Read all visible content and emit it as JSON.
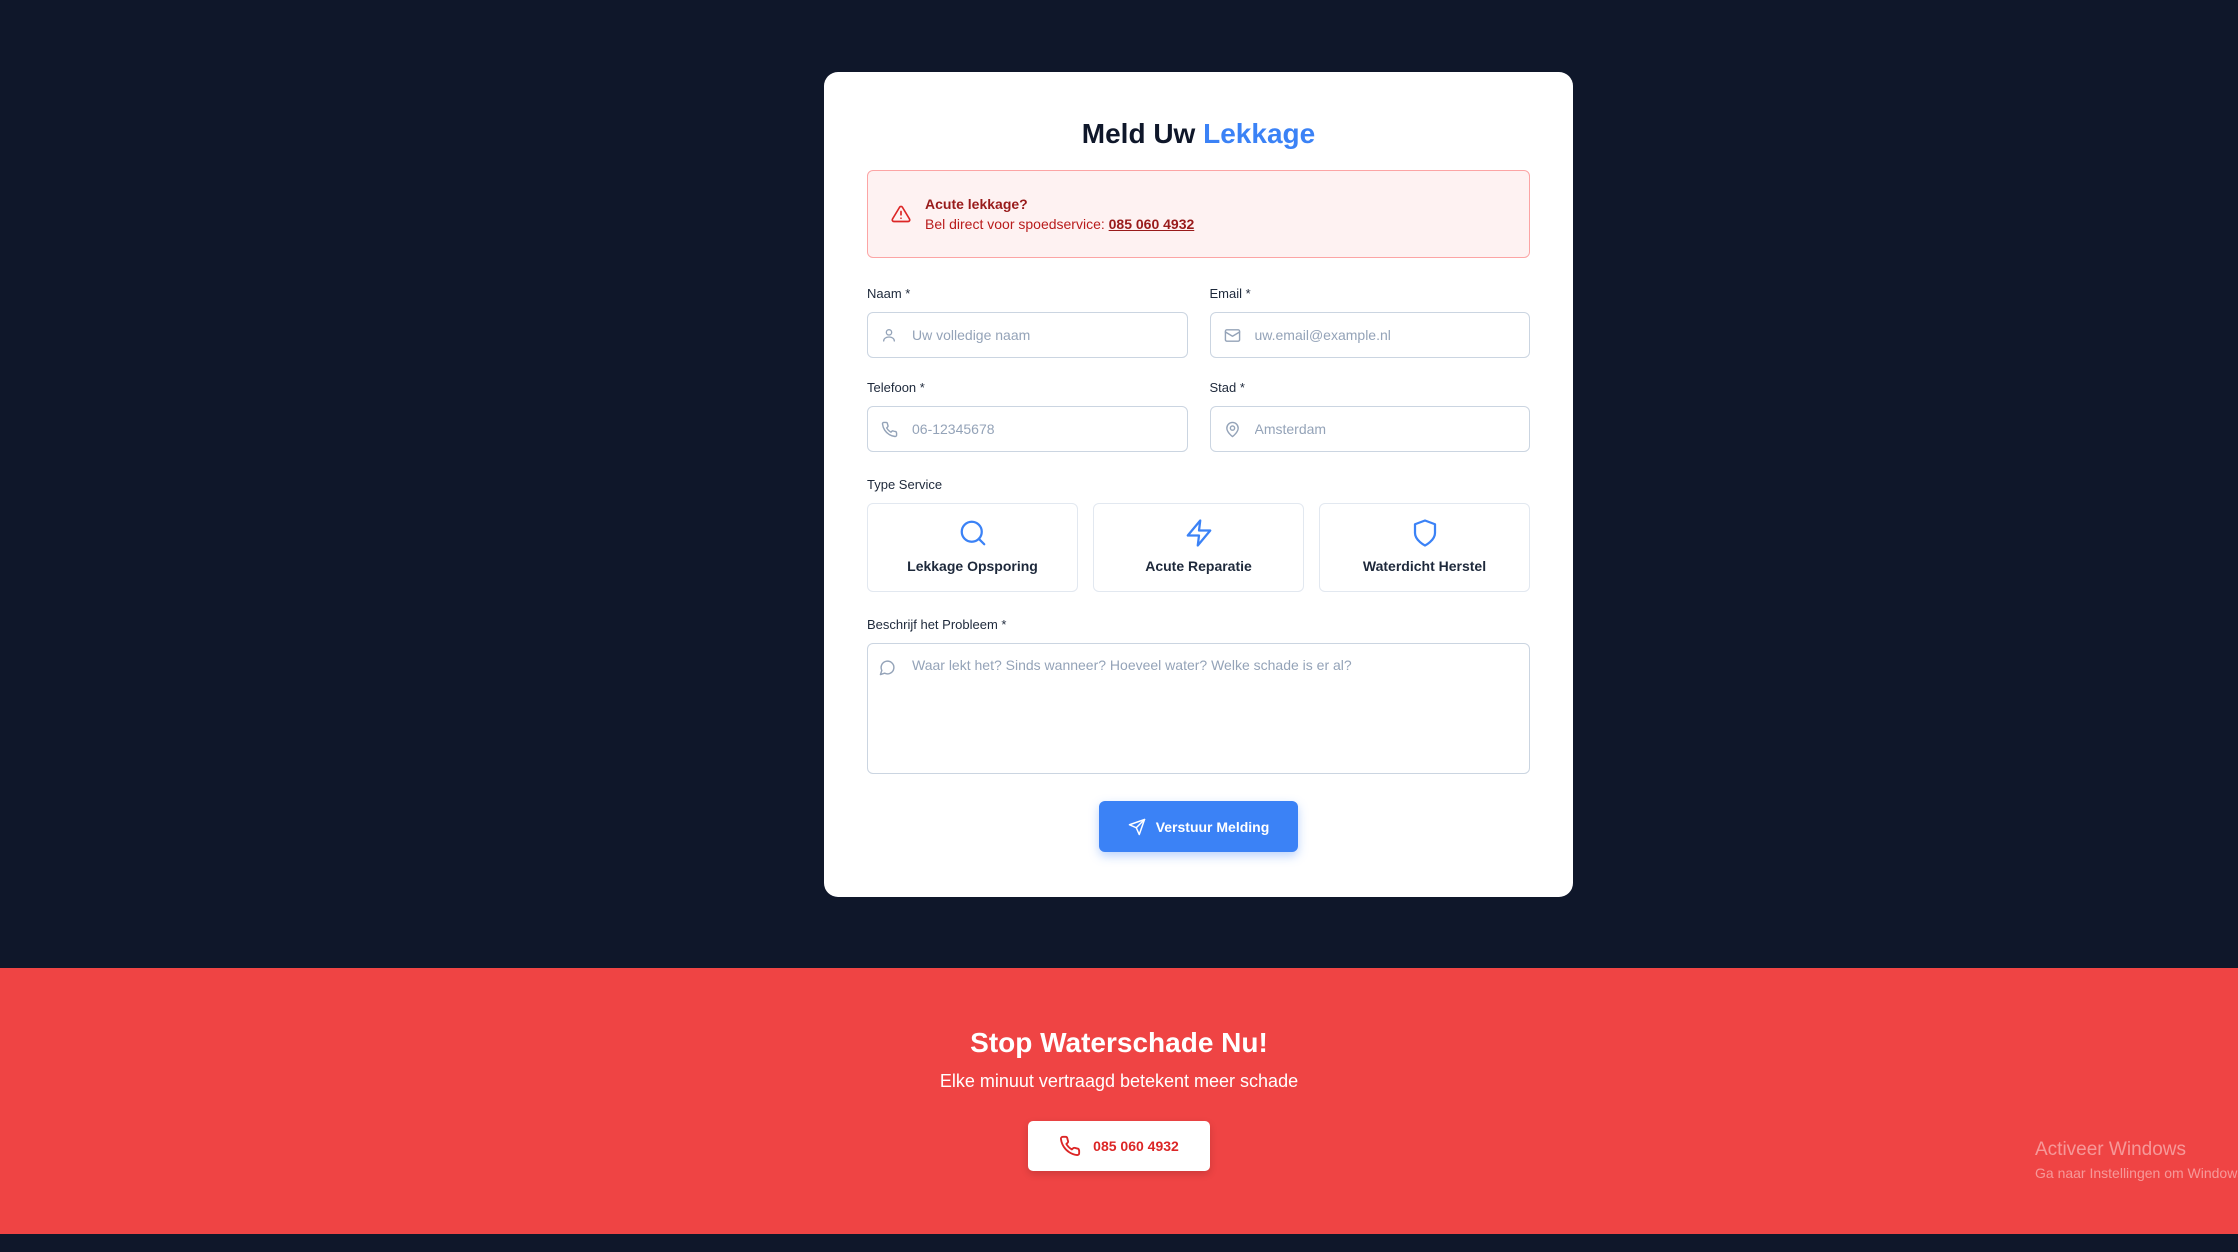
{
  "form": {
    "title_main": "Meld Uw",
    "title_accent": "Lekkage",
    "alert": {
      "icon": "warning-triangle-icon",
      "heading": "Acute lekkage?",
      "text": "Bel direct voor spoedservice: ",
      "phone": "085 060 4932"
    },
    "fields": {
      "name": {
        "label": "Naam *",
        "placeholder": "Uw volledige naam",
        "icon": "user-icon"
      },
      "email": {
        "label": "Email *",
        "placeholder": "uw.email@example.nl",
        "icon": "mail-icon"
      },
      "phone": {
        "label": "Telefoon *",
        "placeholder": "06-12345678",
        "icon": "phone-icon"
      },
      "city": {
        "label": "Stad *",
        "placeholder": "Amsterdam",
        "icon": "map-pin-icon"
      }
    },
    "service_label": "Type Service",
    "services": [
      {
        "label": "Lekkage Opsporing",
        "icon": "search-icon"
      },
      {
        "label": "Acute Reparatie",
        "icon": "lightning-icon"
      },
      {
        "label": "Waterdicht Herstel",
        "icon": "shield-icon"
      }
    ],
    "description": {
      "label": "Beschrijf het Probleem *",
      "placeholder": "Waar lekt het? Sinds wanneer? Hoeveel water? Welke schade is er al?",
      "icon": "message-icon"
    },
    "submit_label": "Verstuur Melding",
    "submit_icon": "send-icon"
  },
  "banner": {
    "title": "Stop Waterschade Nu!",
    "subtitle": "Elke minuut vertraagd betekent meer schade",
    "phone": "085 060 4932",
    "phone_icon": "phone-icon"
  },
  "watermark": {
    "title": "Activeer Windows",
    "subtitle": "Ga naar Instellingen om Windows te activeren."
  },
  "colors": {
    "background": "#0f172a",
    "accent": "#3b82f6",
    "banner": "#ef4444",
    "alert_bg": "#fef2f2",
    "alert_text": "#991b1b"
  }
}
